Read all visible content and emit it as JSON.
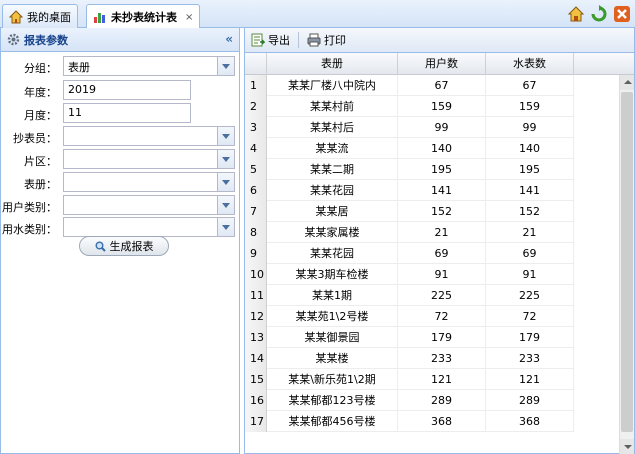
{
  "tabs": [
    {
      "label": "我的桌面",
      "icon": "home-icon"
    },
    {
      "label": "未抄表统计表",
      "icon": "chart-icon",
      "close": "×"
    }
  ],
  "top_icons": [
    "home-icon",
    "refresh-icon",
    "close-window-icon"
  ],
  "left_panel": {
    "title": "报表参数",
    "collapse": "«",
    "fields": [
      {
        "label": "分组：",
        "value": "表册",
        "type": "select"
      },
      {
        "label": "年度：",
        "value": "2019",
        "type": "text"
      },
      {
        "label": "月度：",
        "value": "11",
        "type": "text"
      },
      {
        "label": "抄表员：",
        "value": "",
        "type": "select"
      },
      {
        "label": "片区：",
        "value": "",
        "type": "select"
      },
      {
        "label": "表册：",
        "value": "",
        "type": "select"
      },
      {
        "label": "用户类别：",
        "value": "",
        "type": "select"
      },
      {
        "label": "用水类别：",
        "value": "",
        "type": "select"
      }
    ],
    "generate_label": "生成报表"
  },
  "toolbar": {
    "export_label": "导出",
    "print_label": "打印"
  },
  "grid": {
    "headers": [
      "表册",
      "用户数",
      "水表数"
    ],
    "rows": [
      [
        "1",
        "某某厂楼八中院内",
        "67",
        "67"
      ],
      [
        "2",
        "某某村前",
        "159",
        "159"
      ],
      [
        "3",
        "某某村后",
        "99",
        "99"
      ],
      [
        "4",
        "某某流",
        "140",
        "140"
      ],
      [
        "5",
        "某某二期",
        "195",
        "195"
      ],
      [
        "6",
        "某某花园",
        "141",
        "141"
      ],
      [
        "7",
        "某某居",
        "152",
        "152"
      ],
      [
        "8",
        "某某家属楼",
        "21",
        "21"
      ],
      [
        "9",
        "某某花园",
        "69",
        "69"
      ],
      [
        "10",
        "某某3期车检楼",
        "91",
        "91"
      ],
      [
        "11",
        "某某1期",
        "225",
        "225"
      ],
      [
        "12",
        "某某苑1\\2号楼",
        "72",
        "72"
      ],
      [
        "13",
        "某某御景园",
        "179",
        "179"
      ],
      [
        "14",
        "某某楼",
        "233",
        "233"
      ],
      [
        "15",
        "某某\\新乐苑1\\2期",
        "121",
        "121"
      ],
      [
        "16",
        "某某郁都123号楼",
        "289",
        "289"
      ],
      [
        "17",
        "某某郁都456号楼",
        "368",
        "368"
      ]
    ]
  }
}
